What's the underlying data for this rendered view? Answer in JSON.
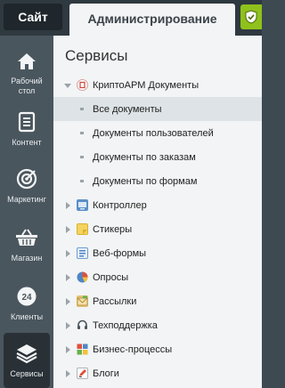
{
  "topbar": {
    "site_tab": "Сайт",
    "admin_tab": "Администрирование"
  },
  "leftnav": {
    "items": [
      {
        "label": "Рабочий стол",
        "icon": "home-icon"
      },
      {
        "label": "Контент",
        "icon": "document-icon"
      },
      {
        "label": "Маркетинг",
        "icon": "target-icon"
      },
      {
        "label": "Магазин",
        "icon": "basket-icon"
      },
      {
        "label": "Клиенты",
        "icon": "clock-24-icon"
      },
      {
        "label": "Сервисы",
        "icon": "layers-icon"
      }
    ]
  },
  "main": {
    "title": "Сервисы",
    "tree": [
      {
        "label": "КриптоАРМ Документы",
        "icon": "cryptoarm-icon",
        "expanded": true,
        "children": [
          {
            "label": "Все документы",
            "selected": true
          },
          {
            "label": "Документы пользователей"
          },
          {
            "label": "Документы по заказам"
          },
          {
            "label": "Документы по формам"
          }
        ]
      },
      {
        "label": "Контроллер",
        "icon": "controller-icon"
      },
      {
        "label": "Стикеры",
        "icon": "sticker-icon"
      },
      {
        "label": "Веб-формы",
        "icon": "webform-icon"
      },
      {
        "label": "Опросы",
        "icon": "poll-icon"
      },
      {
        "label": "Рассылки",
        "icon": "mail-icon"
      },
      {
        "label": "Техподдержка",
        "icon": "headset-icon"
      },
      {
        "label": "Бизнес-процессы",
        "icon": "bizproc-icon"
      },
      {
        "label": "Блоги",
        "icon": "blog-icon"
      }
    ]
  },
  "colors": {
    "accent_green": "#8fc11b",
    "sidebar_bg": "#4a565e",
    "active_nav_bg": "#2a3136",
    "selected_row_bg": "#dde3e6"
  }
}
